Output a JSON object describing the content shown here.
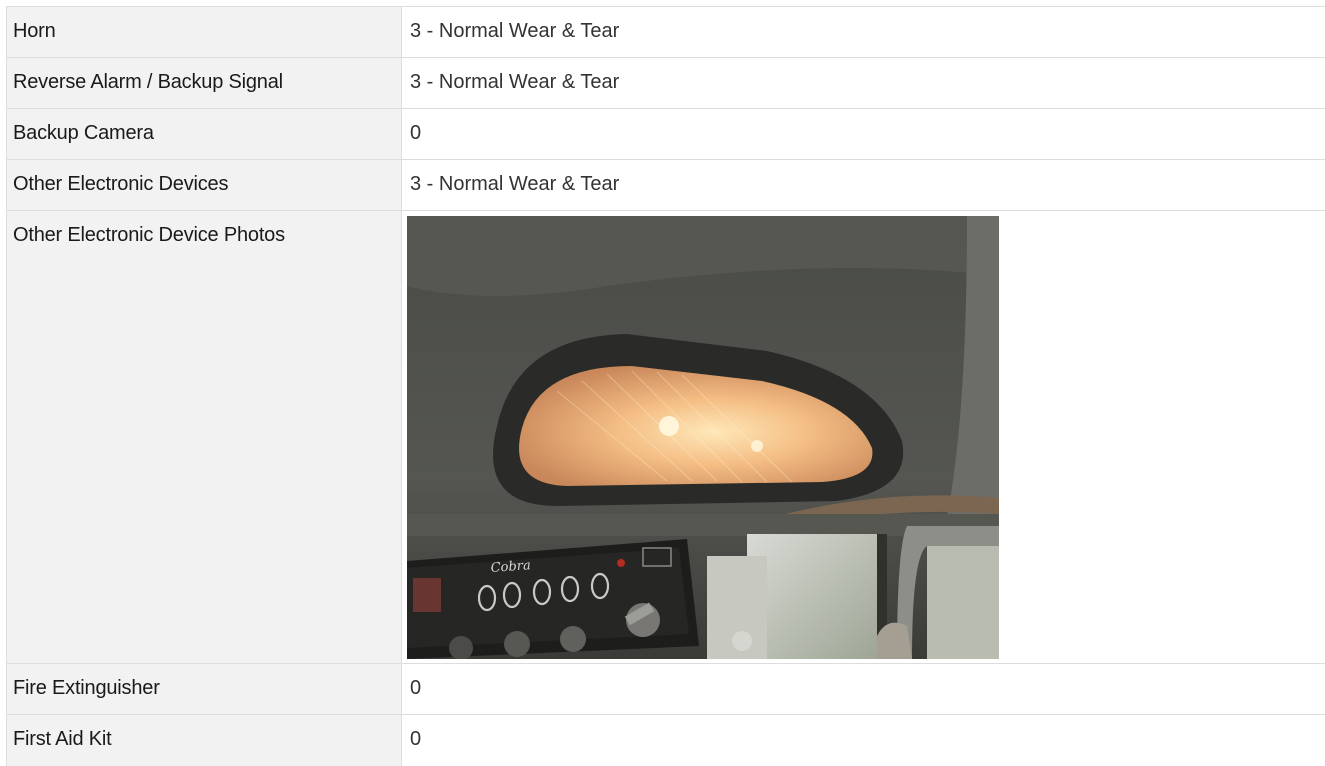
{
  "rows": [
    {
      "label": "Horn",
      "value": "3 - Normal Wear & Tear"
    },
    {
      "label": "Reverse Alarm / Backup Signal",
      "value": "3 - Normal Wear & Tear"
    },
    {
      "label": "Backup Camera",
      "value": "0"
    },
    {
      "label": "Other Electronic Devices",
      "value": "3 - Normal Wear & Tear"
    },
    {
      "label": "Other Electronic Device Photos",
      "photo": "dome-light-and-cb-radio-photo"
    },
    {
      "label": "Fire Extinguisher",
      "value": "0"
    },
    {
      "label": "First Aid Kit",
      "value": "0"
    }
  ],
  "photo_text": {
    "radio_brand": "Cobra"
  },
  "colors": {
    "label_bg": "#f2f2f2",
    "border": "#dddddd",
    "light_glow": "#f2b27a"
  }
}
